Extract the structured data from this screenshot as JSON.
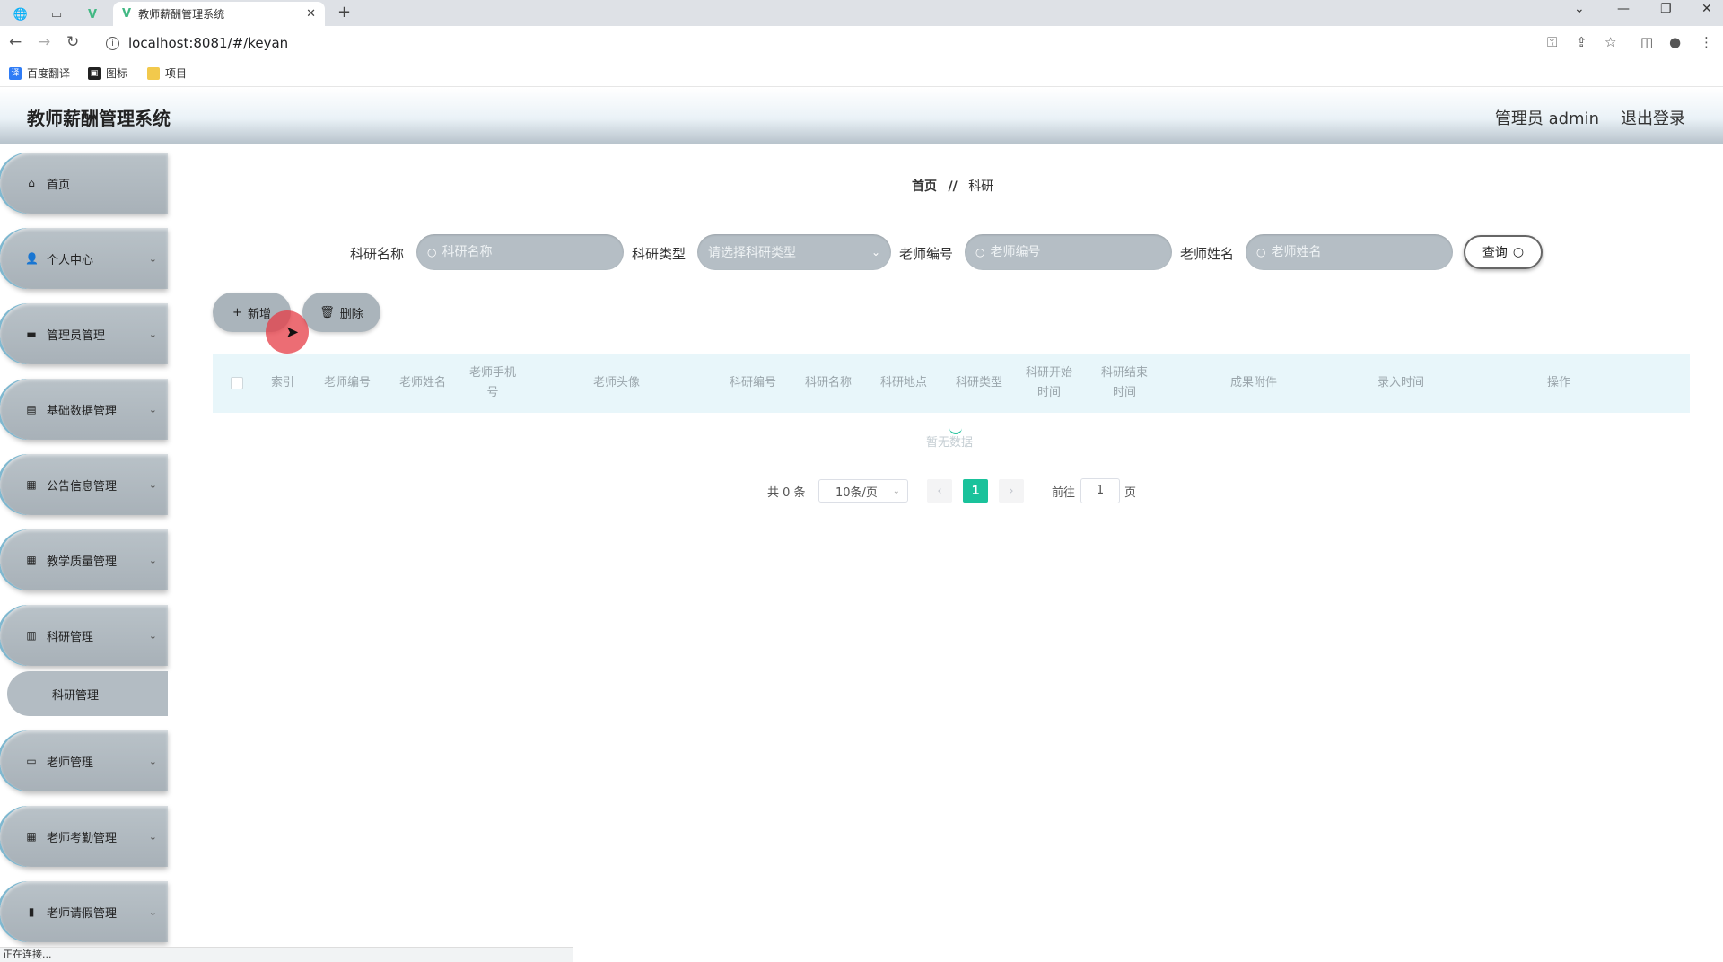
{
  "browser": {
    "tab_title": "教师薪酬管理系统",
    "url": "localhost:8081/#/keyan",
    "bookmarks": [
      "百度翻译",
      "图标",
      "项目"
    ],
    "status_text": "正在连接..."
  },
  "header": {
    "title": "教师薪酬管理系统",
    "admin_label": "管理员 admin",
    "logout_label": "退出登录"
  },
  "sidebar": {
    "items": [
      {
        "label": "首页",
        "icon": "home-icon",
        "has_children": false
      },
      {
        "label": "个人中心",
        "icon": "user-icon",
        "has_children": true
      },
      {
        "label": "管理员管理",
        "icon": "briefcase-icon",
        "has_children": true
      },
      {
        "label": "基础数据管理",
        "icon": "clipboard-icon",
        "has_children": true
      },
      {
        "label": "公告信息管理",
        "icon": "grid-icon",
        "has_children": true
      },
      {
        "label": "教学质量管理",
        "icon": "grid-icon",
        "has_children": true
      },
      {
        "label": "科研管理",
        "icon": "document-icon",
        "has_children": true
      },
      {
        "label": "老师管理",
        "icon": "monitor-icon",
        "has_children": true
      },
      {
        "label": "老师考勤管理",
        "icon": "grid-icon",
        "has_children": true
      },
      {
        "label": "老师请假管理",
        "icon": "chart-icon",
        "has_children": true
      }
    ],
    "active_submenu": "科研管理"
  },
  "breadcrumb": {
    "home": "首页",
    "separator": "//",
    "current": "科研"
  },
  "search": {
    "name_label": "科研名称",
    "name_placeholder": "科研名称",
    "type_label": "科研类型",
    "type_placeholder": "请选择科研类型",
    "teacher_no_label": "老师编号",
    "teacher_no_placeholder": "老师编号",
    "teacher_name_label": "老师姓名",
    "teacher_name_placeholder": "老师姓名",
    "query_label": "查询"
  },
  "actions": {
    "add_label": "新增",
    "delete_label": "删除"
  },
  "table": {
    "columns": [
      "索引",
      "老师编号",
      "老师姓名",
      "老师手机号",
      "老师头像",
      "科研编号",
      "科研名称",
      "科研地点",
      "科研类型",
      "科研开始时间",
      "科研结束时间",
      "成果附件",
      "录入时间",
      "操作"
    ],
    "empty_text": "暂无数据"
  },
  "pagination": {
    "total_label": "共 0 条",
    "page_size": "10条/页",
    "current_page": "1",
    "goto_label": "前往",
    "goto_value": "1",
    "page_suffix": "页"
  },
  "colors": {
    "accent": "#1ac29b",
    "menu_bg": "#aab4bb",
    "table_head_bg": "#e8f6fa"
  }
}
